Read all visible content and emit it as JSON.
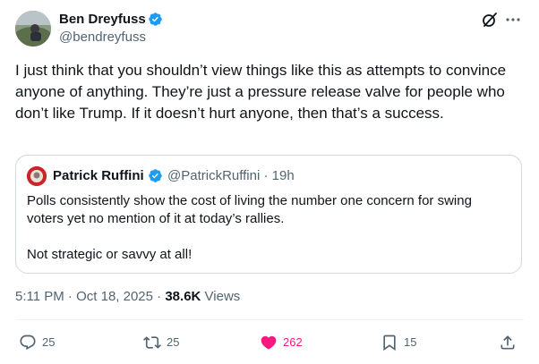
{
  "author": {
    "name": "Ben Dreyfuss",
    "handle": "@bendreyfuss"
  },
  "tweet_text": "I just think that you shouldn’t view things like this as attempts to convince anyone of anything. They’re just a pressure release valve for people who don’t like Trump. If it doesn’t hurt anyone, then that’s a success.",
  "quote": {
    "name": "Patrick Ruffini",
    "handle": "@PatrickRuffini",
    "separator": " · ",
    "time": "19h",
    "text": "Polls consistently show the cost of living the number one concern for swing voters yet no mention of it at today’s rallies.\n\nNot strategic or savvy at all!"
  },
  "meta": {
    "time": "5:11 PM",
    "sep1": " · ",
    "date": "Oct 18, 2025",
    "sep2": " · ",
    "views_count": "38.6K",
    "views_label": " Views"
  },
  "actions": {
    "replies": "25",
    "reposts": "25",
    "likes": "262",
    "bookmarks": "15"
  },
  "colors": {
    "text": "#0f1419",
    "secondary": "#536471",
    "verified": "#1d9bf0",
    "like": "#f91880",
    "border": "#cfd9de"
  },
  "icons": [
    "verified-badge-icon",
    "grok-icon",
    "more-icon",
    "reply-icon",
    "repost-icon",
    "like-icon",
    "bookmark-icon",
    "share-icon"
  ]
}
